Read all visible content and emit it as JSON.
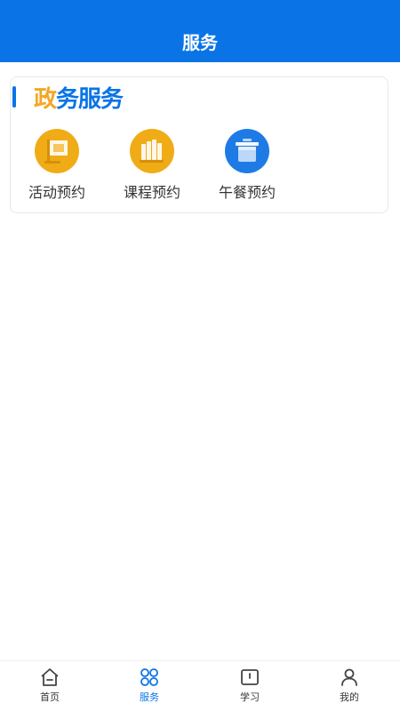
{
  "header": {
    "title": "服务"
  },
  "section": {
    "title_first": "政",
    "title_rest": "务服务",
    "items": [
      {
        "label": "活动预约",
        "icon": "flag-icon",
        "color": "#f0ac16"
      },
      {
        "label": "课程预约",
        "icon": "books-icon",
        "color": "#f0ac16"
      },
      {
        "label": "午餐预约",
        "icon": "lunchbox-icon",
        "color": "#1e7be6"
      }
    ]
  },
  "tabs": [
    {
      "label": "首页",
      "icon": "home-icon",
      "active": false
    },
    {
      "label": "服务",
      "icon": "services-grid-icon",
      "active": true
    },
    {
      "label": "学习",
      "icon": "book-icon",
      "active": false
    },
    {
      "label": "我的",
      "icon": "user-icon",
      "active": false
    }
  ],
  "colors": {
    "primary": "#0a74e6",
    "accent": "#f5a623"
  }
}
